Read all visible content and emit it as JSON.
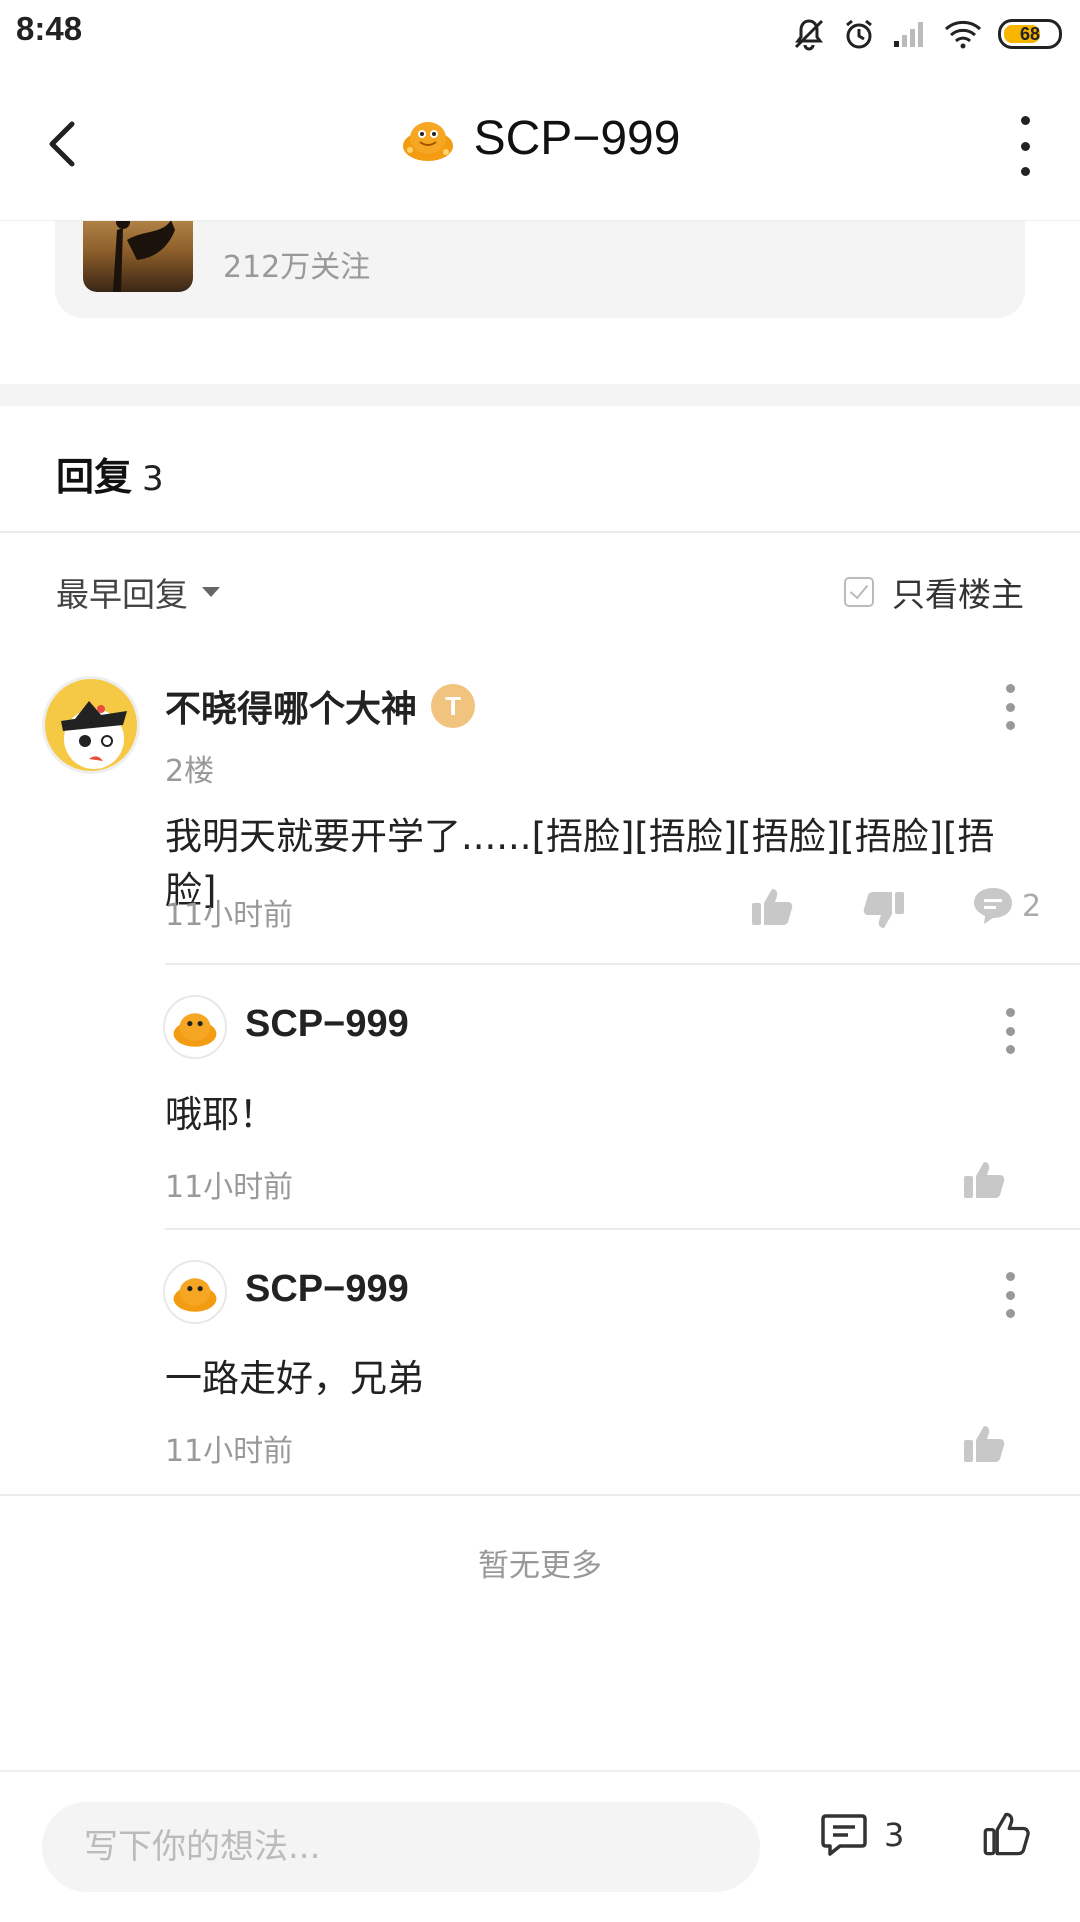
{
  "status_bar": {
    "time": "8:48",
    "battery": "68"
  },
  "header": {
    "title": "SCP−999"
  },
  "game_card": {
    "followers": "212万关注"
  },
  "replies": {
    "label": "回复",
    "count": "3"
  },
  "filters": {
    "sort": "最早回复",
    "only_op": "只看楼主"
  },
  "comment": {
    "username": "不晓得哪个大神",
    "badge": "T",
    "floor": "2楼",
    "text": "我明天就要开学了......[捂脸][捂脸][捂脸][捂脸][捂脸]",
    "time": "11小时前",
    "reply_count": "2"
  },
  "sub_replies": [
    {
      "username": "SCP−999",
      "text": "哦耶！",
      "time": "11小时前"
    },
    {
      "username": "SCP−999",
      "text": "一路走好，兄弟",
      "time": "11小时前"
    }
  ],
  "no_more": "暂无更多",
  "bottom": {
    "placeholder": "写下你的想法...",
    "comment_count": "3"
  },
  "colors": {
    "accent": "#f7b500",
    "muted": "#999999",
    "divider": "#ececec"
  },
  "icons": [
    "mute-icon",
    "alarm-icon",
    "signal-icon",
    "wifi-icon",
    "battery-icon",
    "back-icon",
    "more-icon",
    "thumb-up-icon",
    "thumb-down-icon",
    "comment-icon"
  ]
}
